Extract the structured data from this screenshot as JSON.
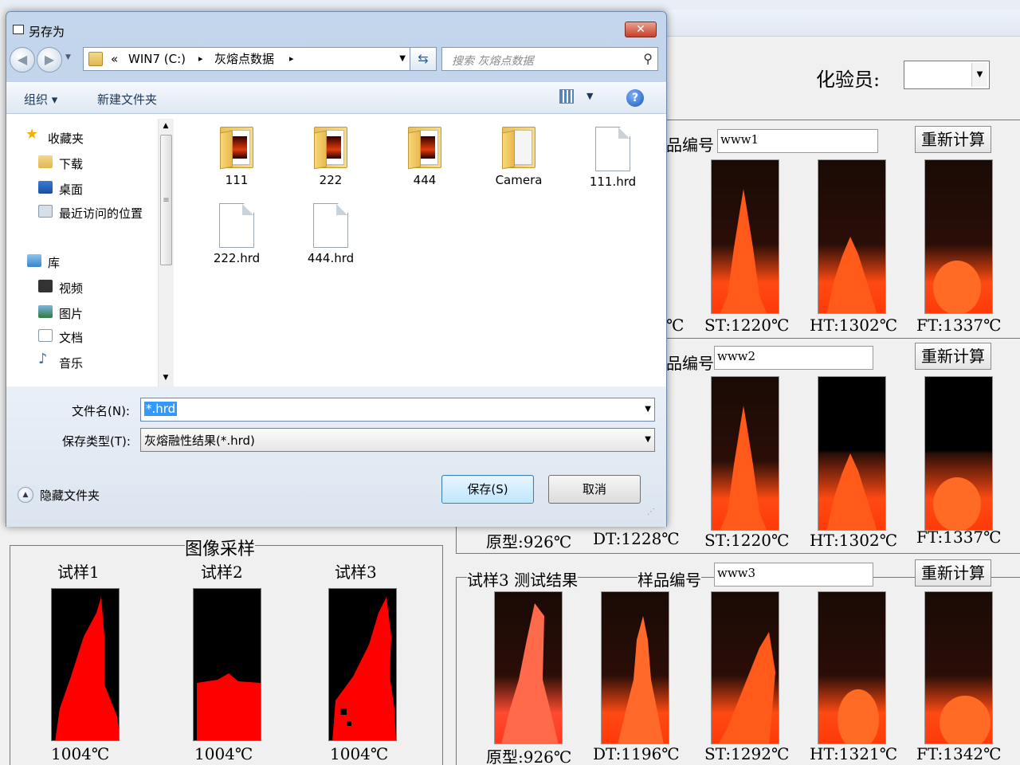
{
  "analyst": {
    "label": "化验员:",
    "value": ""
  },
  "dialog": {
    "title": "另存为",
    "close_glyph": "✕",
    "address_segments": [
      "«",
      "WIN7 (C:)",
      "▸",
      "灰熔点数据",
      "▸"
    ],
    "search_placeholder": "搜索 灰熔点数据",
    "toolbar": {
      "organize": "组织 ▾",
      "new_folder": "新建文件夹",
      "help": "?"
    },
    "nav": {
      "favorites": "收藏夹",
      "downloads": "下载",
      "desktop": "桌面",
      "recent": "最近访问的位置",
      "libraries": "库",
      "video": "视频",
      "pictures": "图片",
      "documents": "文档",
      "music": "音乐"
    },
    "files": [
      {
        "name": "111",
        "kind": "folder"
      },
      {
        "name": "222",
        "kind": "folder"
      },
      {
        "name": "444",
        "kind": "folder"
      },
      {
        "name": "Camera",
        "kind": "folder"
      },
      {
        "name": "111.hrd",
        "kind": "file"
      },
      {
        "name": "222.hrd",
        "kind": "file"
      },
      {
        "name": "444.hrd",
        "kind": "file"
      }
    ],
    "filename_label": "文件名(N):",
    "filename_value": "*.hrd",
    "filetype_label": "保存类型(T):",
    "filetype_value": "灰熔融性结果(*.hrd)",
    "hide_folders": "隐藏文件夹",
    "save_button": "保存(S)",
    "cancel_button": "取消"
  },
  "results": [
    {
      "header": "品编号",
      "sample_id": "www1",
      "recalc": "重新计算",
      "stray": "℃",
      "temps": [
        "ST:1220℃",
        "HT:1302℃",
        "FT:1337℃"
      ]
    },
    {
      "header": "品编号",
      "sample_id": "www2",
      "recalc": "重新计算",
      "temps": [
        "原型:926℃",
        "DT:1228℃",
        "ST:1220℃",
        "HT:1302℃",
        "FT:1337℃"
      ]
    },
    {
      "header": "试样3 测试结果",
      "header2": "样品编号",
      "sample_id": "www3",
      "recalc": "重新计算",
      "temps": [
        "原型:926℃",
        "DT:1196℃",
        "ST:1292℃",
        "HT:1321℃",
        "FT:1342℃"
      ]
    }
  ],
  "sampling": {
    "title": "图像采样",
    "samples": [
      {
        "label": "试样1",
        "temp": "1004℃"
      },
      {
        "label": "试样2",
        "temp": "1004℃"
      },
      {
        "label": "试样3",
        "temp": "1004℃"
      }
    ]
  }
}
